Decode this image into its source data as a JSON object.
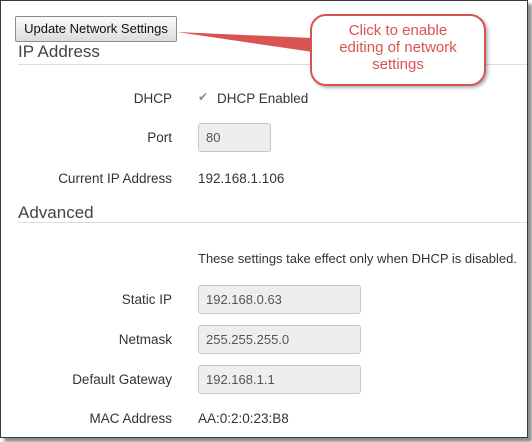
{
  "toolbar": {
    "update_label": "Update Network Settings"
  },
  "callout": {
    "lines": [
      "Click to enable",
      "editing of network",
      "settings"
    ],
    "color": "#d9534f"
  },
  "ip_section": {
    "title": "IP Address",
    "dhcp_label": "DHCP",
    "dhcp_checkbox_label": "DHCP Enabled",
    "dhcp_checked": true,
    "port_label": "Port",
    "port_value": "80",
    "current_ip_label": "Current IP Address",
    "current_ip_value": "192.168.1.106"
  },
  "advanced_section": {
    "title": "Advanced",
    "note": "These settings take effect only when DHCP is disabled.",
    "static_ip_label": "Static IP",
    "static_ip_value": "192.168.0.63",
    "netmask_label": "Netmask",
    "netmask_value": "255.255.255.0",
    "gateway_label": "Default Gateway",
    "gateway_value": "192.168.1.1",
    "mac_label": "MAC Address",
    "mac_value": "AA:0:2:0:23:B8"
  }
}
